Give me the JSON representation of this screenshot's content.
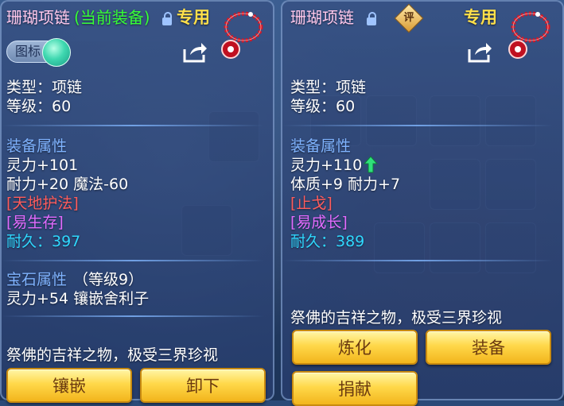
{
  "left_panel": {
    "item_name": "珊瑚项链",
    "equipped_tag": "(当前装备)",
    "exclusive_label": "专用",
    "toggle_label": "图标",
    "type_line": "类型：项链",
    "level_line": "等级：60",
    "equip_attr_header": "装备属性",
    "attr_line1": "灵力+101",
    "attr_line2": "耐力+20 魔法-60",
    "special_skill": "[天地护法]",
    "special_effect": "[易生存]",
    "durability": "耐久：397",
    "gem_header": "宝石属性",
    "gem_level": "（等级9）",
    "gem_line": "灵力+54 镶嵌舍利子",
    "description": "祭佛的吉祥之物，极受三界珍视",
    "buttons": {
      "inlay": "镶嵌",
      "unequip": "卸下"
    }
  },
  "right_panel": {
    "item_name": "珊瑚项链",
    "review_badge": "评",
    "exclusive_label": "专用",
    "type_line": "类型：项链",
    "level_line": "等级：60",
    "equip_attr_header": "装备属性",
    "attr_line1": "灵力+110",
    "attr_line2": "体质+9 耐力+7",
    "special_skill": "[止戈]",
    "special_effect": "[易成长]",
    "durability": "耐久：389",
    "description": "祭佛的吉祥之物，极受三界珍视",
    "buttons": {
      "refine": "炼化",
      "equip": "装备",
      "donate": "捐献"
    }
  },
  "colors": {
    "title_pink": "#ffc8ec",
    "equipped_green": "#36ff36",
    "section_blue": "#7fb3ff",
    "skill_red": "#ff5c5c",
    "effect_magenta": "#e26bff",
    "durability_cyan": "#2fd8ff",
    "exclusive_gold": "#ffe04a",
    "button_gold": "#ffd84a"
  }
}
